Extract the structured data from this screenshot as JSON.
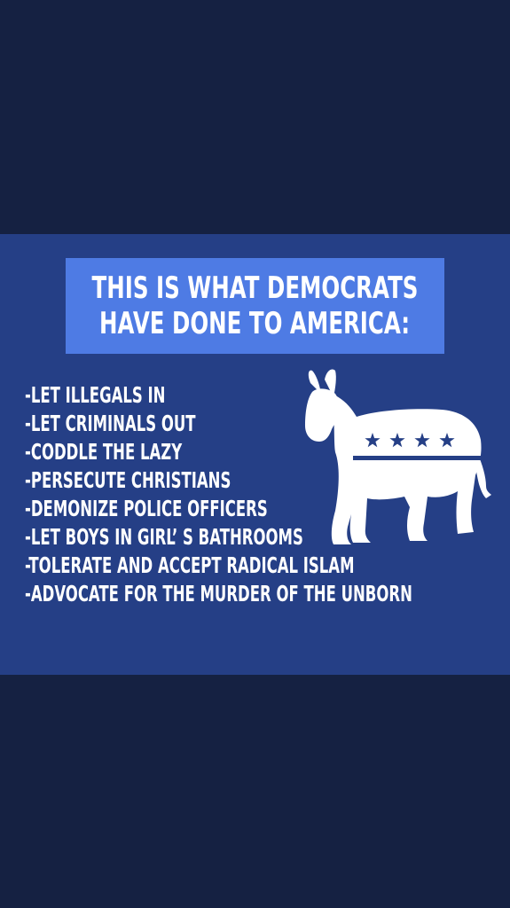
{
  "title": {
    "line1": "THIS IS WHAT DEMOCRATS",
    "line2": "HAVE DONE TO AMERICA:"
  },
  "items": [
    "-LET ILLEGALS IN",
    "-LET CRIMINALS OUT",
    "-CODDLE THE LAZY",
    "-PERSECUTE CHRISTIANS",
    "-DEMONIZE POLICE OFFICERS",
    "-LET BOYS IN GIRL’ S BATHROOMS",
    "-TOLERATE AND ACCEPT RADICAL ISLAM",
    "-ADVOCATE FOR THE MURDER OF THE UNBORN"
  ],
  "logo": {
    "icon": "democratic-donkey-icon",
    "star_count": 4
  },
  "colors": {
    "outer_background": "#152142",
    "panel_background": "#253f86",
    "title_box": "#4e7be4",
    "text": "#ffffff",
    "stars": "#253f86"
  }
}
